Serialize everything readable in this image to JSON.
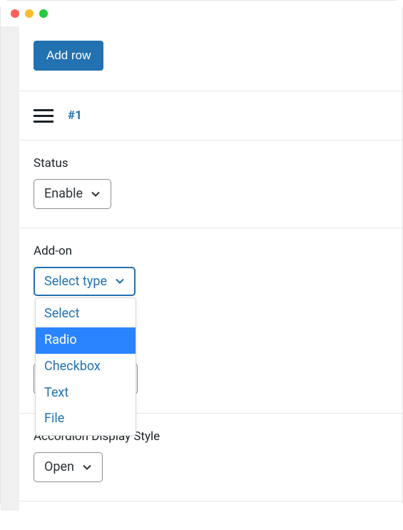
{
  "window": {
    "traffic_lights": [
      "close",
      "minimize",
      "zoom"
    ]
  },
  "toolbar": {
    "add_row_label": "Add row"
  },
  "row": {
    "index_label": "#1"
  },
  "fields": {
    "status": {
      "label": "Status",
      "selected": "Enable"
    },
    "addon": {
      "label": "Add-on",
      "selected": "Select type",
      "options": [
        "Select",
        "Radio",
        "Checkbox",
        "Text",
        "File"
      ],
      "highlighted": "Radio"
    },
    "accordion": {
      "label": "Accordion Display Style",
      "selected": "Open"
    }
  }
}
